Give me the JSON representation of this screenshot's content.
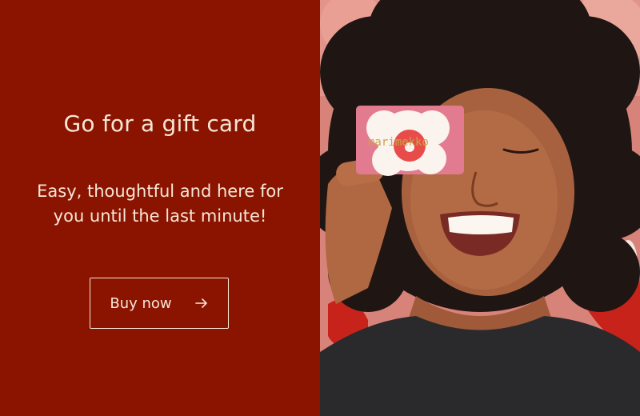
{
  "promo": {
    "headline": "Go for a gift card",
    "subline": "Easy, thoughtful and here for you until the last minute!",
    "button_label": "Buy now",
    "button_icon": "arrow-right-icon"
  },
  "photo": {
    "description_icon": "photo",
    "card_brand_text": "marimekko"
  },
  "colors": {
    "panel_background": "#8a1400",
    "text": "#f7e6d6",
    "card_pink": "#e07a8e",
    "card_flower": "#e84c4a"
  }
}
